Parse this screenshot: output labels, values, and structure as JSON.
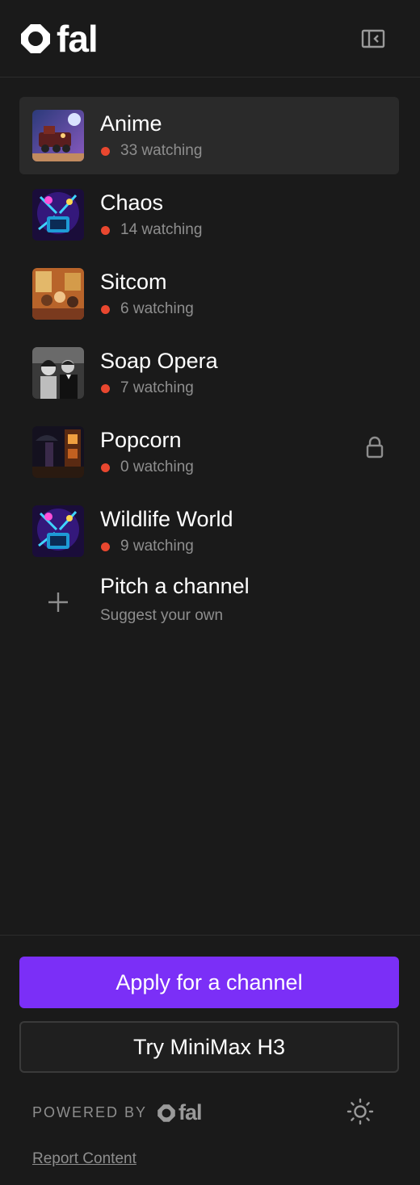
{
  "brand": {
    "name": "fal",
    "logo_icon": "fal-logo-icon"
  },
  "header": {
    "sidebar_toggle_icon": "sidebar-collapse-icon"
  },
  "channels": [
    {
      "name": "Anime",
      "watching": "33 watching",
      "active": true,
      "thumb_icon": "anime-train-thumbnail",
      "locked": false
    },
    {
      "name": "Chaos",
      "watching": "14 watching",
      "active": false,
      "thumb_icon": "chaos-tv-thumbnail",
      "locked": false
    },
    {
      "name": "Sitcom",
      "watching": "6 watching",
      "active": false,
      "thumb_icon": "sitcom-thumbnail",
      "locked": false
    },
    {
      "name": "Soap Opera",
      "watching": "7 watching",
      "active": false,
      "thumb_icon": "soap-opera-thumbnail",
      "locked": false
    },
    {
      "name": "Popcorn",
      "watching": "0 watching",
      "active": false,
      "thumb_icon": "popcorn-thumbnail",
      "locked": true
    },
    {
      "name": "Wildlife World",
      "watching": "9 watching",
      "active": false,
      "thumb_icon": "wildlife-tv-thumbnail",
      "locked": false
    }
  ],
  "pitch": {
    "title": "Pitch a channel",
    "subtitle": "Suggest your own",
    "icon": "plus-icon"
  },
  "footer": {
    "apply_label": "Apply for a channel",
    "try_label": "Try MiniMax H3",
    "powered_by": "POWERED BY",
    "powered_logo_text": "fal",
    "report_label": "Report Content",
    "theme_icon": "sun-icon"
  },
  "colors": {
    "background": "#1a1a1a",
    "accent": "#7b2ff7",
    "live": "#e9472f",
    "muted": "#8e8e8e"
  }
}
